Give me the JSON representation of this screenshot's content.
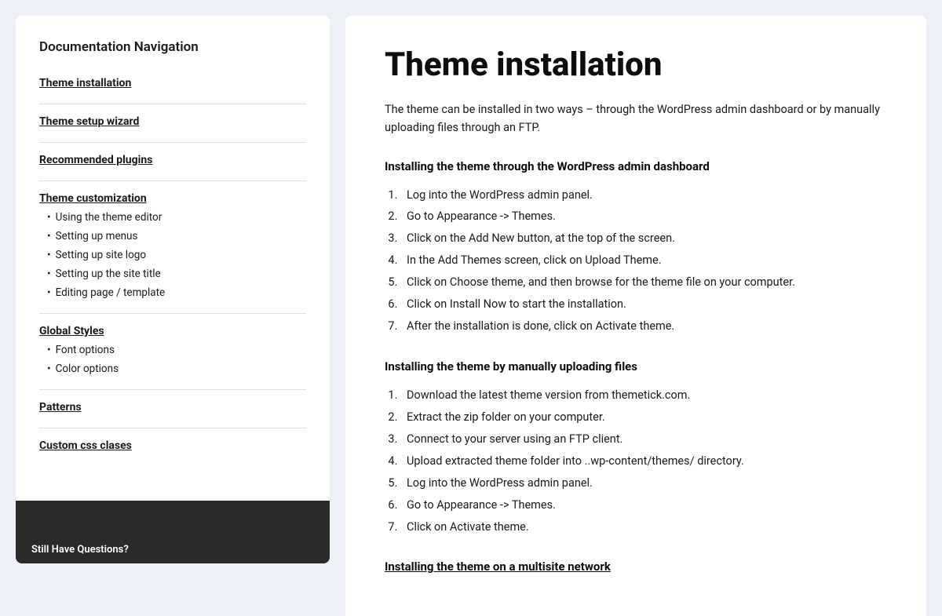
{
  "sidebar": {
    "title": "Documentation Navigation",
    "sections": [
      {
        "id": "theme-installation",
        "label": "Theme installation",
        "type": "link",
        "active": true,
        "children": []
      },
      {
        "id": "theme-setup-wizard",
        "label": "Theme setup wizard",
        "type": "link",
        "active": false,
        "children": []
      },
      {
        "id": "recommended-plugins",
        "label": "Recommended plugins",
        "type": "link",
        "active": false,
        "children": []
      },
      {
        "id": "theme-customization",
        "label": "Theme customization",
        "type": "link-with-children",
        "active": false,
        "children": [
          "Using the theme editor",
          "Setting up menus",
          "Setting up site logo",
          "Setting up the site title",
          "Editing page / template"
        ]
      },
      {
        "id": "global-styles",
        "label": "Global Styles",
        "type": "link-with-children",
        "active": false,
        "children": [
          "Font options",
          "Color options"
        ]
      },
      {
        "id": "patterns",
        "label": "Patterns",
        "type": "link",
        "active": false,
        "children": []
      },
      {
        "id": "custom-css-classes",
        "label": "Custom css clases",
        "type": "link",
        "active": false,
        "children": []
      }
    ]
  },
  "main": {
    "title": "Theme installation",
    "intro": "The theme can be installed in two ways – through the WordPress admin dashboard or by manually uploading files through an FTP.",
    "sections": [
      {
        "id": "admin-dashboard",
        "heading": "Installing the theme through the WordPress admin dashboard",
        "heading_type": "bold",
        "items": [
          "Log into the WordPress admin panel.",
          "Go to Appearance -> Themes.",
          "Click on the Add New button, at the top of the screen.",
          "In the Add Themes screen, click on Upload Theme.",
          "Click on Choose theme, and then browse for the theme file on your computer.",
          "Click on Install Now to start the installation.",
          "After the installation is done, click on Activate theme."
        ]
      },
      {
        "id": "manually-uploading",
        "heading": "Installing the theme by manually uploading files",
        "heading_type": "bold",
        "items": [
          "Download the latest theme version from themetick.com.",
          "Extract the zip folder on your computer.",
          "Connect to your server using an FTP client.",
          "Upload extracted theme folder into ..wp-content/themes/ directory.",
          "Log into the WordPress admin panel.",
          "Go to Appearance -> Themes.",
          "Click on Activate theme."
        ]
      },
      {
        "id": "multisite",
        "heading": "Installing the theme on a multisite network",
        "heading_type": "underline",
        "items": []
      }
    ]
  },
  "bottom_preview": {
    "text": "Still Have Questions?"
  }
}
